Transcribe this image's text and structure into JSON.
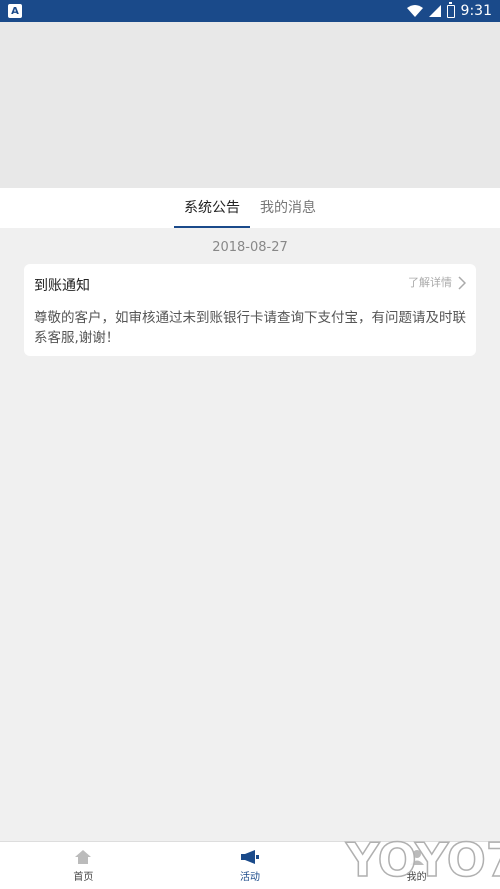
{
  "status_bar": {
    "app_badge": "A",
    "time": "9:31"
  },
  "tabs": [
    {
      "label": "系统公告",
      "active": true
    },
    {
      "label": "我的消息",
      "active": false
    }
  ],
  "notice": {
    "date": "2018-08-27",
    "title": "到账通知",
    "more_label": "了解详情",
    "body": "尊敬的客户，如审核通过未到账银行卡请查询下支付宝，有问题请及时联系客服,谢谢！"
  },
  "bottom_nav": [
    {
      "label": "首页",
      "icon": "home-icon",
      "active": false
    },
    {
      "label": "活动",
      "icon": "megaphone-icon",
      "active": true
    },
    {
      "label": "我的",
      "icon": "user-icon",
      "active": false
    }
  ],
  "watermark_text": "YOYO7",
  "colors": {
    "primary": "#1a4a8a",
    "background": "#f0f0f0",
    "card": "#ffffff"
  }
}
